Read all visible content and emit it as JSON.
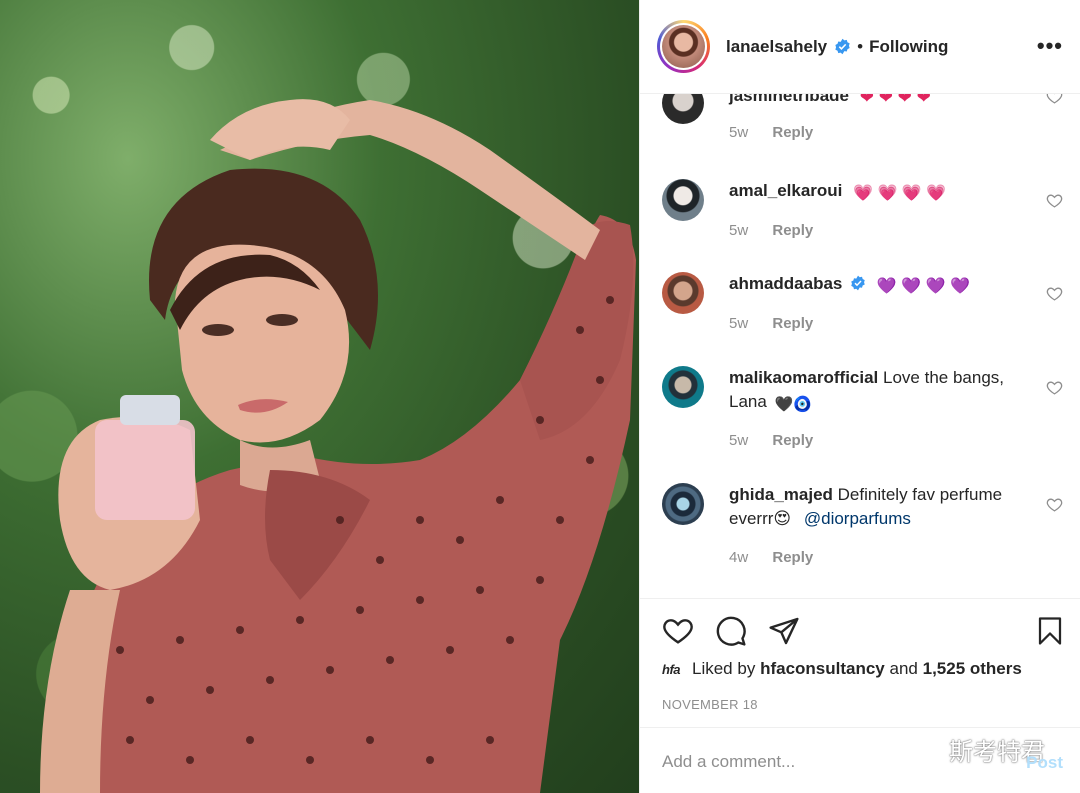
{
  "post": {
    "username": "lanaelsahely",
    "follow_separator": "•",
    "follow_label": "Following",
    "more": "•••"
  },
  "comments": [
    {
      "user": "jasminetribade",
      "text": "",
      "emoji": "❤ ❤ ❤ ❤",
      "emoji_color": "#e0245e",
      "age": "5w",
      "reply": "Reply"
    },
    {
      "user": "amal_elkaroui",
      "text": "",
      "emoji": "💗 💗 💗 💗",
      "emoji_color": "#f0479f",
      "age": "5w",
      "reply": "Reply"
    },
    {
      "user": "ahmaddaabas",
      "text": "",
      "emoji": "💜 💜 💜 💜",
      "emoji_color": "#a24ee3",
      "age": "5w",
      "reply": "Reply",
      "verified": true
    },
    {
      "user": "malikaomarofficial",
      "text": "Love the bangs,",
      "text2": "Lana",
      "emoji": "🖤🧿",
      "age": "5w",
      "reply": "Reply"
    },
    {
      "user": "ghida_majed",
      "text": "Definitely fav perfume",
      "text2": "everrr😍",
      "mention": "@diorparfums",
      "age": "4w",
      "reply": "Reply"
    }
  ],
  "likes": {
    "avatar_text": "hfa",
    "prefix": "Liked by",
    "liker": "hfaconsultancy",
    "conj": "and",
    "others": "1,525 others"
  },
  "date": "NOVEMBER 18",
  "composer": {
    "placeholder": "Add a comment...",
    "post_label": "Post"
  },
  "watermark": "斯考特君",
  "colors": {
    "verified": "#3897f0",
    "meta": "#8e8e8e",
    "post_disabled": "#b2dffc",
    "mention": "#00376b"
  }
}
